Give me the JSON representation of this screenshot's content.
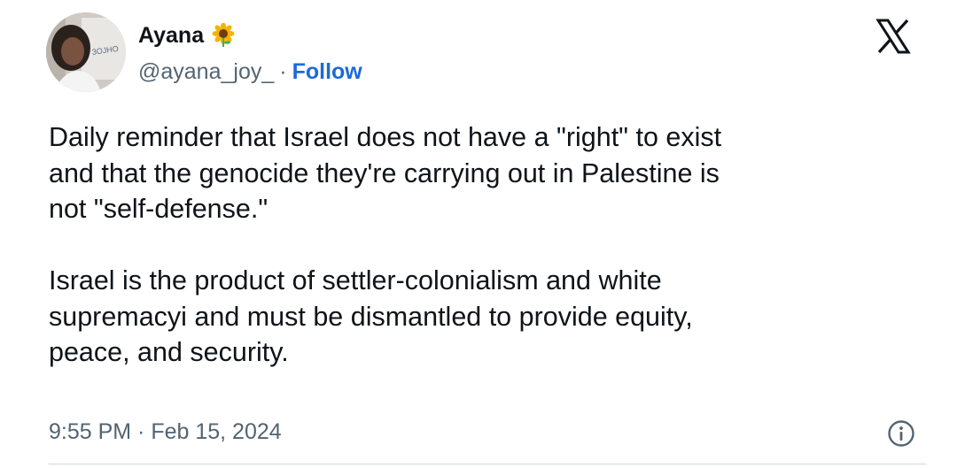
{
  "author": {
    "display_name": "Ayana",
    "name_emoji_icon": "sunflower-icon",
    "handle": "@ayana_joy_",
    "separator": "·",
    "follow_label": "Follow",
    "avatar_sign_text": "ЗОЈНО"
  },
  "header": {
    "brand_icon": "x-logo-icon"
  },
  "tweet": {
    "paragraphs": [
      "Daily reminder that Israel does not have a \"right\" to exist\nand that the genocide they're carrying out in Palestine is\nnot \"self-defense.\"",
      "Israel is the product of settler-colonialism and white\nsupremacyi and must be dismantled to provide equity,\npeace, and security."
    ],
    "timestamp": "9:55 PM · Feb 15, 2024",
    "info_icon": "info-icon"
  },
  "colors": {
    "text_primary": "#0f1419",
    "text_secondary": "#536471",
    "link": "#1d6ad8",
    "divider": "#cfd9de"
  }
}
